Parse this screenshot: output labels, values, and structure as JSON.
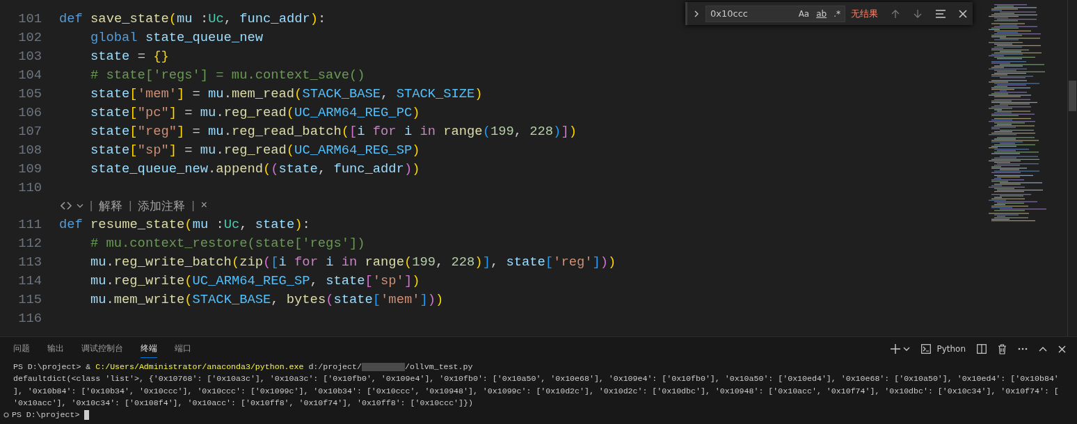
{
  "find_widget": {
    "value": "0x10ccc",
    "options": [
      {
        "label": "Aa",
        "selected": false
      },
      {
        "label": "ab",
        "selected": false
      },
      {
        "label": ".*",
        "selected": false
      }
    ],
    "result": "无结果"
  },
  "editor": {
    "rows": [
      {
        "kind": "code",
        "number": "101",
        "tokens": [
          {
            "kind": "kw",
            "text": "def "
          },
          {
            "kind": "fn",
            "text": "save_state"
          },
          {
            "kind": "b1",
            "text": "("
          },
          {
            "kind": "var",
            "text": "mu"
          },
          {
            "kind": "p",
            "text": " :"
          },
          {
            "kind": "type",
            "text": "Uc"
          },
          {
            "kind": "p",
            "text": ", "
          },
          {
            "kind": "var",
            "text": "func_addr"
          },
          {
            "kind": "b1",
            "text": ")"
          },
          {
            "kind": "p",
            "text": ":"
          }
        ],
        "children": [
          {
            "kind": "code",
            "number": "102",
            "tokens": [
              {
                "kind": "kw",
                "text": "global "
              },
              {
                "kind": "var",
                "text": "state_queue_new"
              }
            ]
          },
          {
            "kind": "code",
            "number": "103",
            "tokens": [
              {
                "kind": "var",
                "text": "state"
              },
              {
                "kind": "p",
                "text": " = "
              },
              {
                "kind": "b1",
                "text": "{}"
              }
            ]
          },
          {
            "kind": "code",
            "number": "104",
            "tokens": [
              {
                "kind": "cmt",
                "text": "# state['regs'] = mu.context_save()"
              }
            ]
          },
          {
            "kind": "code",
            "number": "105",
            "tokens": [
              {
                "kind": "var",
                "text": "state"
              },
              {
                "kind": "b1",
                "text": "["
              },
              {
                "kind": "str",
                "text": "'mem'"
              },
              {
                "kind": "b1",
                "text": "]"
              },
              {
                "kind": "p",
                "text": " = "
              },
              {
                "kind": "var",
                "text": "mu"
              },
              {
                "kind": "p",
                "text": "."
              },
              {
                "kind": "fn",
                "text": "mem_read"
              },
              {
                "kind": "b1",
                "text": "("
              },
              {
                "kind": "const",
                "text": "STACK_BASE"
              },
              {
                "kind": "p",
                "text": ", "
              },
              {
                "kind": "const",
                "text": "STACK_SIZE"
              },
              {
                "kind": "b1",
                "text": ")"
              }
            ]
          },
          {
            "kind": "code",
            "number": "106",
            "tokens": [
              {
                "kind": "var",
                "text": "state"
              },
              {
                "kind": "b1",
                "text": "["
              },
              {
                "kind": "str",
                "text": "\"pc\""
              },
              {
                "kind": "b1",
                "text": "]"
              },
              {
                "kind": "p",
                "text": " = "
              },
              {
                "kind": "var",
                "text": "mu"
              },
              {
                "kind": "p",
                "text": "."
              },
              {
                "kind": "fn",
                "text": "reg_read"
              },
              {
                "kind": "b1",
                "text": "("
              },
              {
                "kind": "const",
                "text": "UC_ARM64_REG_PC"
              },
              {
                "kind": "b1",
                "text": ")"
              }
            ]
          },
          {
            "kind": "code",
            "number": "107",
            "tokens": [
              {
                "kind": "var",
                "text": "state"
              },
              {
                "kind": "b1",
                "text": "["
              },
              {
                "kind": "str",
                "text": "\"reg\""
              },
              {
                "kind": "b1",
                "text": "]"
              },
              {
                "kind": "p",
                "text": " = "
              },
              {
                "kind": "var",
                "text": "mu"
              },
              {
                "kind": "p",
                "text": "."
              },
              {
                "kind": "fn",
                "text": "reg_read_batch"
              },
              {
                "kind": "b1",
                "text": "("
              },
              {
                "kind": "b2",
                "text": "["
              },
              {
                "kind": "var",
                "text": "i "
              },
              {
                "kind": "ctl",
                "text": "for "
              },
              {
                "kind": "var",
                "text": "i "
              },
              {
                "kind": "ctl",
                "text": "in "
              },
              {
                "kind": "fn",
                "text": "range"
              },
              {
                "kind": "b3",
                "text": "("
              },
              {
                "kind": "num",
                "text": "199"
              },
              {
                "kind": "p",
                "text": ", "
              },
              {
                "kind": "num",
                "text": "228"
              },
              {
                "kind": "b3",
                "text": ")"
              },
              {
                "kind": "b2",
                "text": "]"
              },
              {
                "kind": "b1",
                "text": ")"
              }
            ]
          },
          {
            "kind": "code",
            "number": "108",
            "tokens": [
              {
                "kind": "var",
                "text": "state"
              },
              {
                "kind": "b1",
                "text": "["
              },
              {
                "kind": "str",
                "text": "\"sp\""
              },
              {
                "kind": "b1",
                "text": "]"
              },
              {
                "kind": "p",
                "text": " = "
              },
              {
                "kind": "var",
                "text": "mu"
              },
              {
                "kind": "p",
                "text": "."
              },
              {
                "kind": "fn",
                "text": "reg_read"
              },
              {
                "kind": "b1",
                "text": "("
              },
              {
                "kind": "const",
                "text": "UC_ARM64_REG_SP"
              },
              {
                "kind": "b1",
                "text": ")"
              }
            ]
          },
          {
            "kind": "code",
            "number": "109",
            "tokens": [
              {
                "kind": "var",
                "text": "state_queue_new"
              },
              {
                "kind": "p",
                "text": "."
              },
              {
                "kind": "fn",
                "text": "append"
              },
              {
                "kind": "b1",
                "text": "("
              },
              {
                "kind": "b2",
                "text": "("
              },
              {
                "kind": "var",
                "text": "state"
              },
              {
                "kind": "p",
                "text": ", "
              },
              {
                "kind": "var",
                "text": "func_addr"
              },
              {
                "kind": "b2",
                "text": ")"
              },
              {
                "kind": "b1",
                "text": ")"
              }
            ]
          }
        ]
      },
      {
        "kind": "code",
        "number": "110"
      },
      {
        "kind": "codelens",
        "parts": [
          {
            "kind": "sep",
            "text": "|"
          },
          {
            "kind": "link",
            "text": "解释"
          },
          {
            "kind": "sep",
            "text": "|"
          },
          {
            "kind": "link",
            "text": "添加注释"
          },
          {
            "kind": "sep",
            "text": "|"
          },
          {
            "kind": "close",
            "text": "×"
          }
        ]
      },
      {
        "kind": "code",
        "number": "111",
        "tokens": [
          {
            "kind": "kw",
            "text": "def "
          },
          {
            "kind": "fn",
            "text": "resume_state"
          },
          {
            "kind": "b1",
            "text": "("
          },
          {
            "kind": "var",
            "text": "mu"
          },
          {
            "kind": "p",
            "text": " :"
          },
          {
            "kind": "type",
            "text": "Uc"
          },
          {
            "kind": "p",
            "text": ", "
          },
          {
            "kind": "var",
            "text": "state"
          },
          {
            "kind": "b1",
            "text": ")"
          },
          {
            "kind": "p",
            "text": ":"
          }
        ],
        "children": [
          {
            "kind": "code",
            "number": "112",
            "tokens": [
              {
                "kind": "cmt",
                "text": "# mu.context_restore(state['regs'])"
              }
            ]
          },
          {
            "kind": "code",
            "number": "113",
            "tokens": [
              {
                "kind": "var",
                "text": "mu"
              },
              {
                "kind": "p",
                "text": "."
              },
              {
                "kind": "fn",
                "text": "reg_write_batch"
              },
              {
                "kind": "b1",
                "text": "("
              },
              {
                "kind": "fn",
                "text": "zip"
              },
              {
                "kind": "b2",
                "text": "("
              },
              {
                "kind": "b3",
                "text": "["
              },
              {
                "kind": "var",
                "text": "i "
              },
              {
                "kind": "ctl",
                "text": "for "
              },
              {
                "kind": "var",
                "text": "i "
              },
              {
                "kind": "ctl",
                "text": "in "
              },
              {
                "kind": "fn",
                "text": "range"
              },
              {
                "kind": "b1",
                "text": "("
              },
              {
                "kind": "num",
                "text": "199"
              },
              {
                "kind": "p",
                "text": ", "
              },
              {
                "kind": "num",
                "text": "228"
              },
              {
                "kind": "b1",
                "text": ")"
              },
              {
                "kind": "b3",
                "text": "]"
              },
              {
                "kind": "p",
                "text": ", "
              },
              {
                "kind": "var",
                "text": "state"
              },
              {
                "kind": "b3",
                "text": "["
              },
              {
                "kind": "str",
                "text": "'reg'"
              },
              {
                "kind": "b3",
                "text": "]"
              },
              {
                "kind": "b2",
                "text": ")"
              },
              {
                "kind": "b1",
                "text": ")"
              }
            ]
          },
          {
            "kind": "code",
            "number": "114",
            "tokens": [
              {
                "kind": "var",
                "text": "mu"
              },
              {
                "kind": "p",
                "text": "."
              },
              {
                "kind": "fn",
                "text": "reg_write"
              },
              {
                "kind": "b1",
                "text": "("
              },
              {
                "kind": "const",
                "text": "UC_ARM64_REG_SP"
              },
              {
                "kind": "p",
                "text": ", "
              },
              {
                "kind": "var",
                "text": "state"
              },
              {
                "kind": "b2",
                "text": "["
              },
              {
                "kind": "str",
                "text": "'sp'"
              },
              {
                "kind": "b2",
                "text": "]"
              },
              {
                "kind": "b1",
                "text": ")"
              }
            ]
          },
          {
            "kind": "code",
            "number": "115",
            "tokens": [
              {
                "kind": "var",
                "text": "mu"
              },
              {
                "kind": "p",
                "text": "."
              },
              {
                "kind": "fn",
                "text": "mem_write"
              },
              {
                "kind": "b1",
                "text": "("
              },
              {
                "kind": "const",
                "text": "STACK_BASE"
              },
              {
                "kind": "p",
                "text": ", "
              },
              {
                "kind": "fn",
                "text": "bytes"
              },
              {
                "kind": "b2",
                "text": "("
              },
              {
                "kind": "var",
                "text": "state"
              },
              {
                "kind": "b3",
                "text": "["
              },
              {
                "kind": "str",
                "text": "'mem'"
              },
              {
                "kind": "b3",
                "text": "]"
              },
              {
                "kind": "b2",
                "text": ")"
              },
              {
                "kind": "b1",
                "text": ")"
              }
            ]
          }
        ]
      },
      {
        "kind": "code",
        "number": "116"
      }
    ]
  },
  "panel": {
    "tabs": [
      {
        "label": "问题",
        "selected": false
      },
      {
        "label": "输出",
        "selected": false
      },
      {
        "label": "调试控制台",
        "selected": false
      },
      {
        "label": "终端",
        "selected": true
      },
      {
        "label": "端口",
        "selected": false
      }
    ],
    "terminal_name": "Python",
    "lines": [
      {
        "kind": "command",
        "parts": [
          {
            "kind": "text",
            "text": "PS D:\\project> & "
          },
          {
            "kind": "exe",
            "text": "C:/Users/Administrator/anaconda3/python.exe"
          },
          {
            "kind": "text",
            "text": " d:/project/"
          },
          {
            "kind": "redacted"
          },
          {
            "kind": "text",
            "text": "/ollvm_test.py"
          }
        ]
      },
      {
        "kind": "output",
        "text": "defaultdict(<class 'list'>, {'0x10768': ['0x10a3c'], '0x10a3c': ['0x10fb0', '0x109e4'], '0x10fb0': ['0x10a50', '0x10e68'], '0x109e4': ['0x10fb0'], '0x10a50': ['0x10ed4'], '0x10e68': ['0x10a50'], '0x10ed4': ['0x10b84'"
      },
      {
        "kind": "output",
        "text": "], '0x10b84': ['0x10b34', '0x10ccc'], '0x10ccc': ['0x1099c'], '0x10b34': ['0x10ccc', '0x10948'], '0x1099c': ['0x10d2c'], '0x10d2c': ['0x10dbc'], '0x10948': ['0x10acc', '0x10f74'], '0x10dbc': ['0x10c34'], '0x10f74': ["
      },
      {
        "kind": "output",
        "text": "'0x10acc'], '0x10c34': ['0x108f4'], '0x10acc': ['0x10ff8', '0x10f74'], '0x10ff8': ['0x10ccc']})"
      },
      {
        "kind": "prompt",
        "text": "PS D:\\project>"
      }
    ]
  }
}
